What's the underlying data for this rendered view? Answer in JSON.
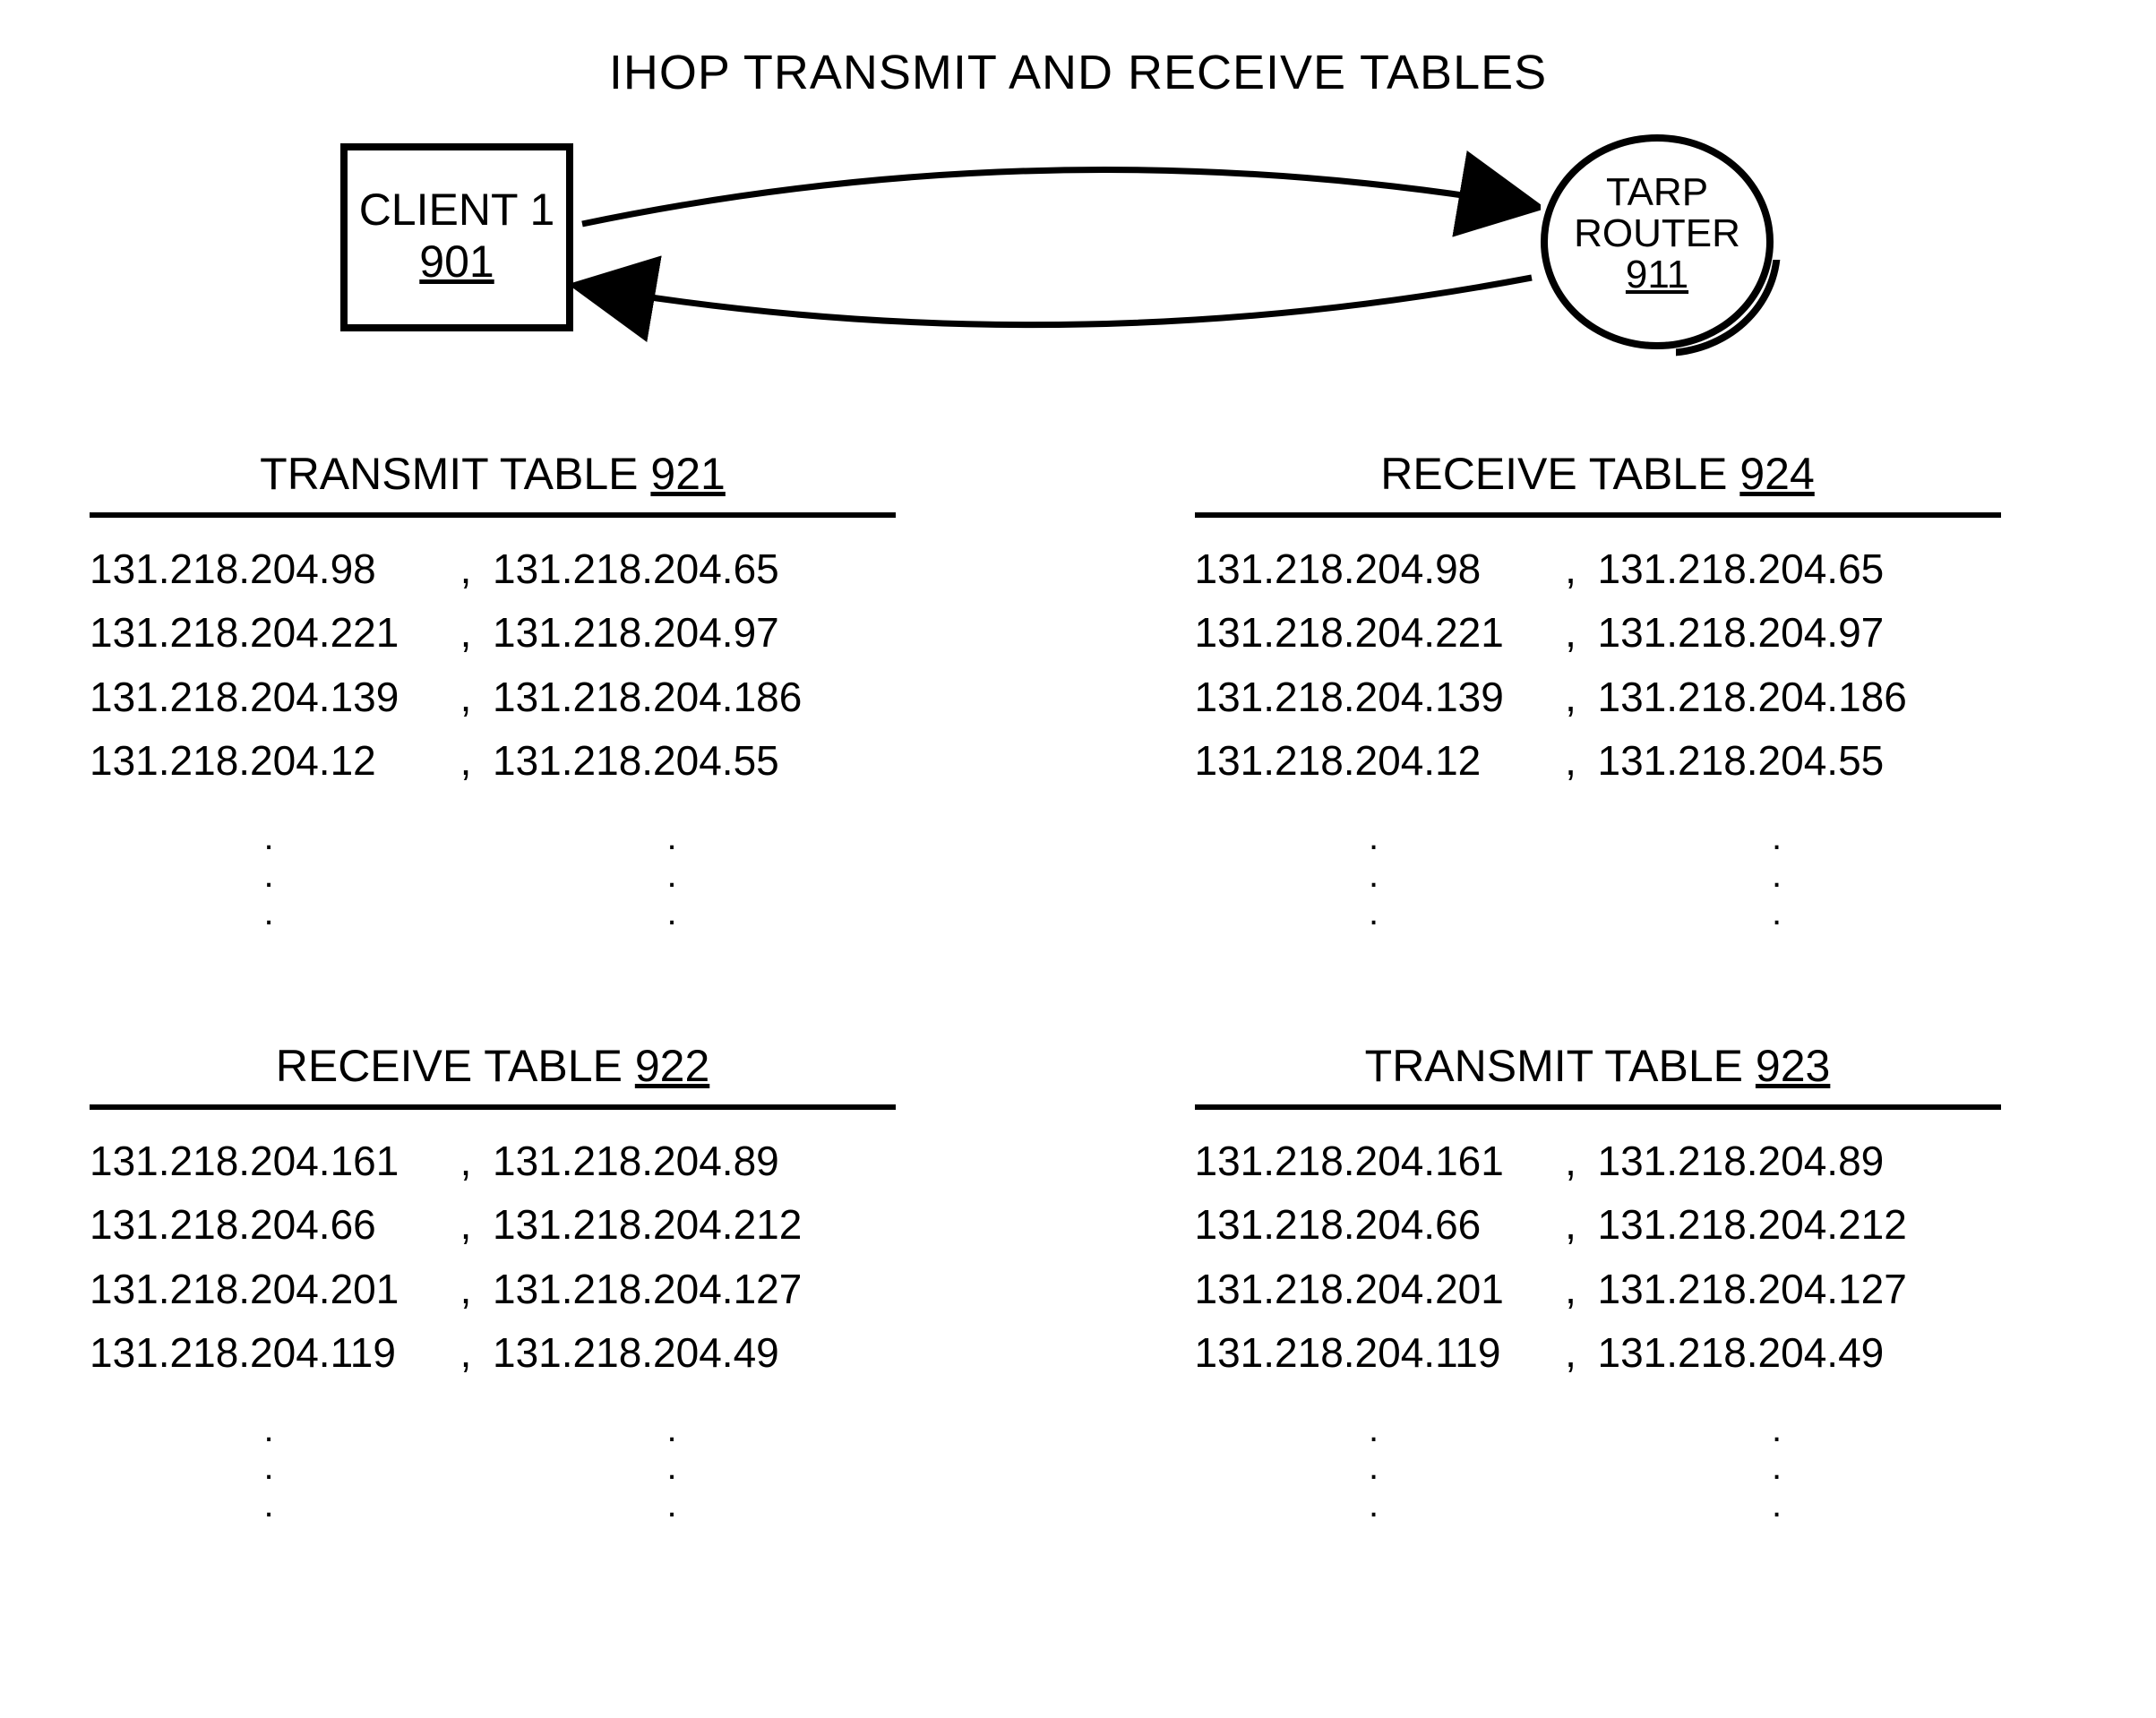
{
  "title": "IHOP TRANSMIT AND RECEIVE TABLES",
  "client": {
    "label": "CLIENT 1",
    "ref": "901"
  },
  "router": {
    "line1": "TARP",
    "line2": "ROUTER",
    "ref": "911"
  },
  "tables": {
    "t921": {
      "label": "TRANSMIT TABLE",
      "ref": "921",
      "rows": [
        {
          "a": "131.218.204.98",
          "b": "131.218.204.65"
        },
        {
          "a": "131.218.204.221",
          "b": "131.218.204.97"
        },
        {
          "a": "131.218.204.139",
          "b": "131.218.204.186"
        },
        {
          "a": "131.218.204.12",
          "b": "131.218.204.55"
        }
      ]
    },
    "t924": {
      "label": "RECEIVE TABLE",
      "ref": "924",
      "rows": [
        {
          "a": "131.218.204.98",
          "b": "131.218.204.65"
        },
        {
          "a": "131.218.204.221",
          "b": "131.218.204.97"
        },
        {
          "a": "131.218.204.139",
          "b": "131.218.204.186"
        },
        {
          "a": "131.218.204.12",
          "b": "131.218.204.55"
        }
      ]
    },
    "t922": {
      "label": "RECEIVE TABLE",
      "ref": "922",
      "rows": [
        {
          "a": "131.218.204.161",
          "b": "131.218.204.89"
        },
        {
          "a": "131.218.204.66",
          "b": "131.218.204.212"
        },
        {
          "a": "131.218.204.201",
          "b": "131.218.204.127"
        },
        {
          "a": "131.218.204.119",
          "b": "131.218.204.49"
        }
      ]
    },
    "t923": {
      "label": "TRANSMIT TABLE",
      "ref": "923",
      "rows": [
        {
          "a": "131.218.204.161",
          "b": "131.218.204.89"
        },
        {
          "a": "131.218.204.66",
          "b": "131.218.204.212"
        },
        {
          "a": "131.218.204.201",
          "b": "131.218.204.127"
        },
        {
          "a": "131.218.204.119",
          "b": "131.218.204.49"
        }
      ]
    }
  },
  "sep": ",",
  "dot": "."
}
